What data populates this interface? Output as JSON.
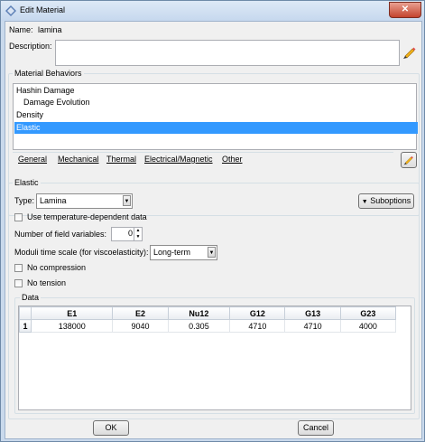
{
  "window": {
    "title": "Edit Material",
    "close_label": "✕"
  },
  "name": {
    "label": "Name:",
    "value": "lamina"
  },
  "description": {
    "label": "Description:",
    "value": ""
  },
  "behaviors": {
    "legend": "Material Behaviors",
    "items": [
      {
        "label": "Hashin Damage",
        "indent": false,
        "selected": false
      },
      {
        "label": "Damage Evolution",
        "indent": true,
        "selected": false
      },
      {
        "label": "Density",
        "indent": false,
        "selected": false
      },
      {
        "label": "Elastic",
        "indent": false,
        "selected": true
      }
    ]
  },
  "menus": {
    "general": "General",
    "mechanical": "Mechanical",
    "thermal": "Thermal",
    "electrical": "Electrical/Magnetic",
    "other": "Other"
  },
  "elastic": {
    "legend": "Elastic",
    "type_label": "Type:",
    "type_value": "Lamina",
    "suboptions_label": "Suboptions",
    "temp_dependent_label": "Use temperature-dependent data",
    "temp_dependent_checked": false,
    "field_vars_label": "Number of field variables:",
    "field_vars_value": "0",
    "moduli_label": "Moduli time scale (for viscoelasticity):",
    "moduli_value": "Long-term",
    "no_compression_label": "No compression",
    "no_compression_checked": false,
    "no_tension_label": "No tension",
    "no_tension_checked": false
  },
  "data_table": {
    "legend": "Data",
    "columns": [
      "E1",
      "E2",
      "Nu12",
      "G12",
      "G13",
      "G23"
    ],
    "rows": [
      {
        "index": "1",
        "cells": [
          "138000",
          "9040",
          "0.305",
          "4710",
          "4710",
          "4000"
        ]
      }
    ]
  },
  "buttons": {
    "ok": "OK",
    "cancel": "Cancel"
  },
  "colors": {
    "selection": "#3399ff",
    "titlebar": "#c6d8ee",
    "close": "#c4432e"
  }
}
